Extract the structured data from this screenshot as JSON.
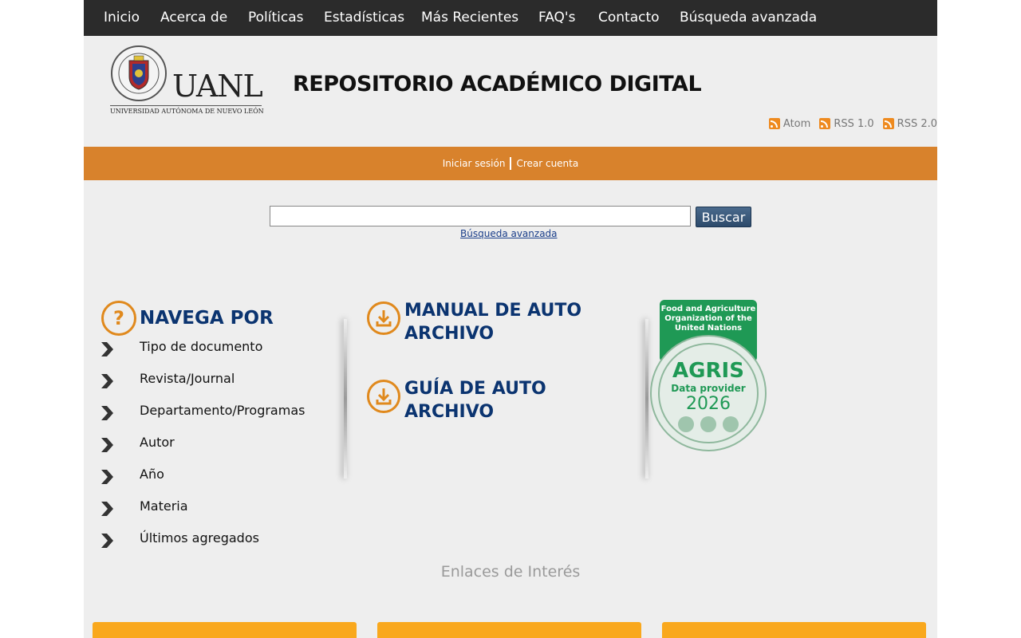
{
  "nav": {
    "items": [
      "Inicio",
      "Acerca de",
      "Políticas",
      "Estadísticas",
      "Más Recientes",
      "FAQ's",
      "Contacto",
      "Búsqueda avanzada"
    ]
  },
  "logo": {
    "name": "UANL",
    "subtitle": "UNIVERSIDAD AUTÓNOMA DE NUEVO LEÓN",
    "icon": "university-seal"
  },
  "site_title": "REPOSITORIO ACADÉMICO DIGITAL",
  "feeds": [
    "Atom",
    "RSS 1.0",
    "RSS 2.0"
  ],
  "auth": {
    "login": "Iniciar sesión",
    "register": "Crear cuenta"
  },
  "search": {
    "value": "",
    "placeholder": "",
    "button": "Buscar",
    "advanced_link": "Búsqueda avanzada"
  },
  "browse": {
    "title": "NAVEGA POR",
    "icon": "question-icon",
    "items": [
      "Tipo de documento",
      "Revista/Journal",
      "Departamento/Programas",
      "Autor",
      "Año",
      "Materia",
      "Últimos agregados"
    ]
  },
  "resources": [
    {
      "title": "MANUAL DE AUTO ARCHIVO",
      "icon": "download-icon"
    },
    {
      "title": "GUÍA DE AUTO ARCHIVO",
      "icon": "download-icon"
    }
  ],
  "agris": {
    "org": "Food and Agriculture Organization of the United Nations",
    "name": "AGRIS",
    "subtitle": "Data provider",
    "year": "2026"
  },
  "links_section": {
    "title": "Enlaces de Interés"
  },
  "colors": {
    "nav_bg": "#2b2b2b",
    "orange_bar": "#d8822c",
    "accent_orange": "#e0891d",
    "title_blue": "#0b3470",
    "agris_green": "#1f9955",
    "card_yellow": "#f9a81d"
  }
}
